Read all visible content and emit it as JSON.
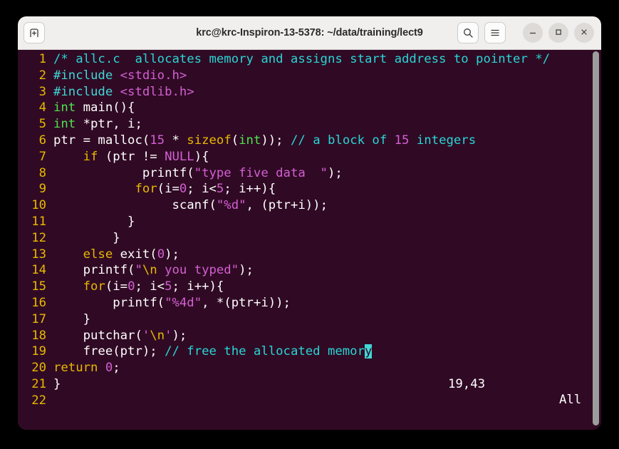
{
  "window": {
    "title": "krc@krc-Inspiron-13-5378: ~/data/training/lect9",
    "background_color": "#300a24",
    "titlebar_color": "#f0efee"
  },
  "titlebar": {
    "new_tab_label": "new-tab",
    "search_label": "search",
    "menu_label": "menu",
    "minimize_label": "minimize",
    "maximize_label": "maximize",
    "close_label": "close"
  },
  "editor": {
    "filename": "allc.c",
    "colors": {
      "comment": "#29d5d5",
      "string": "#d45fd4",
      "preprocessor": "#41d7d7",
      "type": "#4ee24e",
      "keyword": "#e8b900",
      "number": "#d45fd4",
      "foreground": "#ffffff",
      "linenumber": "#e8b900",
      "cursor": "#41d7d7"
    },
    "lines": [
      {
        "n": "1",
        "tokens": [
          {
            "t": "/* allc.c  allocates memory and assigns start address to pointer */",
            "c": "c-com"
          }
        ]
      },
      {
        "n": "2",
        "tokens": [
          {
            "t": "#include ",
            "c": "c-pre"
          },
          {
            "t": "<stdio.h>",
            "c": "c-str"
          }
        ]
      },
      {
        "n": "3",
        "tokens": [
          {
            "t": "#include ",
            "c": "c-pre"
          },
          {
            "t": "<stdlib.h>",
            "c": "c-str"
          }
        ]
      },
      {
        "n": "4",
        "tokens": [
          {
            "t": "int",
            "c": "c-type"
          },
          {
            "t": " main(){",
            "c": "c-fg"
          }
        ]
      },
      {
        "n": "5",
        "tokens": [
          {
            "t": "int",
            "c": "c-type"
          },
          {
            "t": " *ptr, i;",
            "c": "c-fg"
          }
        ]
      },
      {
        "n": "6",
        "tokens": [
          {
            "t": "ptr = malloc(",
            "c": "c-fg"
          },
          {
            "t": "15",
            "c": "c-num"
          },
          {
            "t": " * ",
            "c": "c-fg"
          },
          {
            "t": "sizeof",
            "c": "c-kw"
          },
          {
            "t": "(",
            "c": "c-fg"
          },
          {
            "t": "int",
            "c": "c-type"
          },
          {
            "t": ")); ",
            "c": "c-fg"
          },
          {
            "t": "// a block of ",
            "c": "c-com"
          },
          {
            "t": "15",
            "c": "c-num"
          },
          {
            "t": " integers",
            "c": "c-com"
          }
        ]
      },
      {
        "n": "7",
        "tokens": [
          {
            "t": "    ",
            "c": "c-fg"
          },
          {
            "t": "if",
            "c": "c-kw"
          },
          {
            "t": " (ptr != ",
            "c": "c-fg"
          },
          {
            "t": "NULL",
            "c": "c-str"
          },
          {
            "t": "){",
            "c": "c-fg"
          }
        ]
      },
      {
        "n": "8",
        "tokens": [
          {
            "t": "            printf(",
            "c": "c-fg"
          },
          {
            "t": "\"type five data  \"",
            "c": "c-str"
          },
          {
            "t": ");",
            "c": "c-fg"
          }
        ]
      },
      {
        "n": "9",
        "tokens": [
          {
            "t": "           ",
            "c": "c-fg"
          },
          {
            "t": "for",
            "c": "c-kw"
          },
          {
            "t": "(i=",
            "c": "c-fg"
          },
          {
            "t": "0",
            "c": "c-num"
          },
          {
            "t": "; i<",
            "c": "c-fg"
          },
          {
            "t": "5",
            "c": "c-num"
          },
          {
            "t": "; i++){",
            "c": "c-fg"
          }
        ]
      },
      {
        "n": "10",
        "tokens": [
          {
            "t": "                scanf(",
            "c": "c-fg"
          },
          {
            "t": "\"%d\"",
            "c": "c-str"
          },
          {
            "t": ", (ptr+i));",
            "c": "c-fg"
          }
        ]
      },
      {
        "n": "11",
        "tokens": [
          {
            "t": "          }",
            "c": "c-fg"
          }
        ]
      },
      {
        "n": "12",
        "tokens": [
          {
            "t": "        }",
            "c": "c-fg"
          }
        ]
      },
      {
        "n": "13",
        "tokens": [
          {
            "t": "    ",
            "c": "c-fg"
          },
          {
            "t": "else",
            "c": "c-kw"
          },
          {
            "t": " exit(",
            "c": "c-fg"
          },
          {
            "t": "0",
            "c": "c-num"
          },
          {
            "t": ");",
            "c": "c-fg"
          }
        ]
      },
      {
        "n": "14",
        "tokens": [
          {
            "t": "    printf(",
            "c": "c-fg"
          },
          {
            "t": "\"",
            "c": "c-str"
          },
          {
            "t": "\\n",
            "c": "c-kw"
          },
          {
            "t": " you typed\"",
            "c": "c-str"
          },
          {
            "t": ");",
            "c": "c-fg"
          }
        ]
      },
      {
        "n": "15",
        "tokens": [
          {
            "t": "    ",
            "c": "c-fg"
          },
          {
            "t": "for",
            "c": "c-kw"
          },
          {
            "t": "(i=",
            "c": "c-fg"
          },
          {
            "t": "0",
            "c": "c-num"
          },
          {
            "t": "; i<",
            "c": "c-fg"
          },
          {
            "t": "5",
            "c": "c-num"
          },
          {
            "t": "; i++){",
            "c": "c-fg"
          }
        ]
      },
      {
        "n": "16",
        "tokens": [
          {
            "t": "        printf(",
            "c": "c-fg"
          },
          {
            "t": "\"%4d\"",
            "c": "c-str"
          },
          {
            "t": ", *(ptr+i));",
            "c": "c-fg"
          }
        ]
      },
      {
        "n": "17",
        "tokens": [
          {
            "t": "    }",
            "c": "c-fg"
          }
        ]
      },
      {
        "n": "18",
        "tokens": [
          {
            "t": "    putchar(",
            "c": "c-fg"
          },
          {
            "t": "'",
            "c": "c-str"
          },
          {
            "t": "\\n",
            "c": "c-kw"
          },
          {
            "t": "'",
            "c": "c-str"
          },
          {
            "t": ");",
            "c": "c-fg"
          }
        ]
      },
      {
        "n": "19",
        "tokens": [
          {
            "t": "    free(ptr); ",
            "c": "c-fg"
          },
          {
            "t": "// free the allocated memor",
            "c": "c-com"
          },
          {
            "t": "y",
            "c": "cursor"
          }
        ]
      },
      {
        "n": "20",
        "tokens": [
          {
            "t": "return",
            "c": "c-kw"
          },
          {
            "t": " ",
            "c": "c-fg"
          },
          {
            "t": "0",
            "c": "c-num"
          },
          {
            "t": ";",
            "c": "c-fg"
          }
        ]
      },
      {
        "n": "21",
        "tokens": [
          {
            "t": "}",
            "c": "c-fg"
          }
        ]
      },
      {
        "n": "22",
        "tokens": []
      }
    ]
  },
  "status": {
    "ruler": "19,43",
    "scroll": "All"
  }
}
